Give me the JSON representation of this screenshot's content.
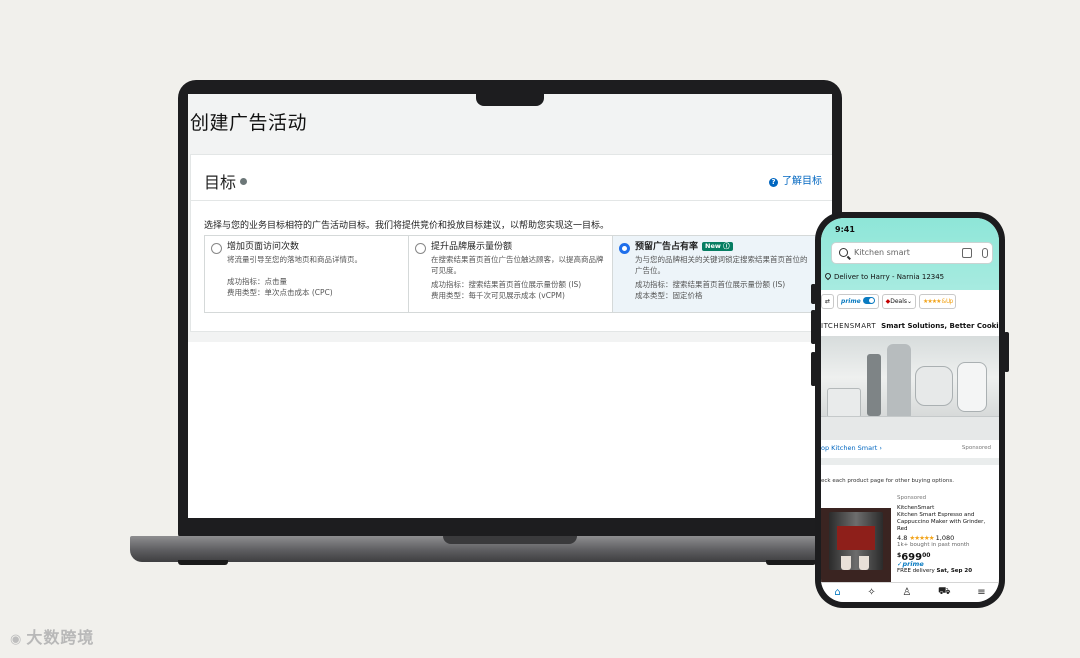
{
  "campaign": {
    "page_title": "创建广告活动",
    "goal_title": "目标",
    "learn_link": "了解目标",
    "description": "选择与您的业务目标相符的广告活动目标。我们将提供竞价和投放目标建议，以帮助您实现这一目标。",
    "options": [
      {
        "title": "增加页面访问次数",
        "desc": "将流量引导至您的落地页和商品详情页。",
        "metric": "成功指标：点击量",
        "cost": "费用类型：单次点击成本 (CPC)",
        "selected": false,
        "badge": ""
      },
      {
        "title": "提升品牌展示量份额",
        "desc": "在搜索结果首页首位广告位触达顾客，以提高商品牌可见度。",
        "metric": "成功指标：搜索结果首页首位展示量份额 (IS)",
        "cost": "费用类型：每千次可见展示成本 (vCPM)",
        "selected": false,
        "badge": ""
      },
      {
        "title": "预留广告占有率",
        "desc": "为与您的品牌相关的关键词锁定搜索结果首页首位的广告位。",
        "metric": "成功指标：搜索结果首页首位展示量份额 (IS)",
        "cost": "成本类型：固定价格",
        "selected": true,
        "badge": "New"
      }
    ]
  },
  "phone": {
    "time": "9:41",
    "search_placeholder": "Kitchen smart",
    "deliver": "Deliver to Harry - Narnia 12345",
    "chips": {
      "prime": "prime",
      "deals": "Deals",
      "rating": "★★★★ & Up"
    },
    "brand_logo": "ITCHENSMART",
    "brand_tagline": "Smart Solutions, Better Cooking",
    "shop_link": "op Kitchen Smart ›",
    "sponsored_label": "Sponsored",
    "note": "eck each product page for other buying options.",
    "product": {
      "sponsored": "Sponsored",
      "brand": "KitchenSmart",
      "name": "Kitchen Smart Espresso and Cappuccino Maker with Grinder, Red",
      "rating": "4.8",
      "stars": "★★★★★",
      "reviews": "1,080",
      "bought": "1k+ bought in past month",
      "price_symbol": "$",
      "price_whole": "699",
      "price_fraction": "00",
      "prime": "prime",
      "delivery_prefix": "FREE delivery",
      "delivery_date": "Sat, Sep 20"
    },
    "accent": "#0a7bc1"
  },
  "watermark": "大数跨境"
}
